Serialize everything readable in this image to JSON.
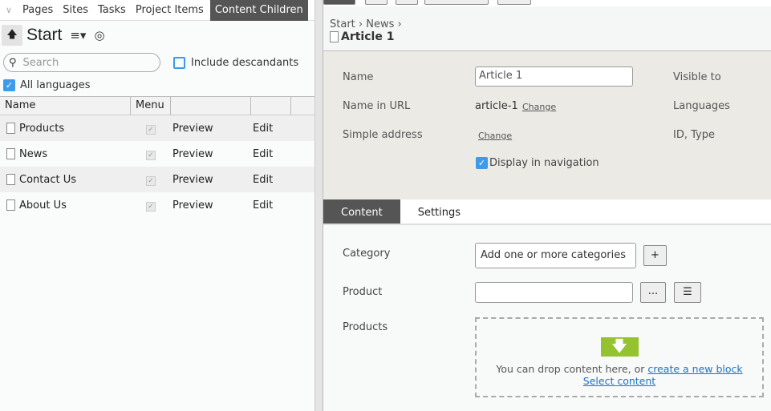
{
  "left": {
    "tabs": [
      "Pages",
      "Sites",
      "Tasks",
      "Project Items",
      "Content Children"
    ],
    "active_tab": "Content Children",
    "title": "Start",
    "search_placeholder": "Search",
    "include_descendants": "Include descandants",
    "all_languages": "All languages",
    "columns": [
      "Name",
      "Menu",
      "",
      "",
      ""
    ],
    "rows": [
      {
        "name": "Products",
        "preview": "Preview",
        "edit": "Edit"
      },
      {
        "name": "News",
        "preview": "Preview",
        "edit": "Edit"
      },
      {
        "name": "Contact Us",
        "preview": "Preview",
        "edit": "Edit"
      },
      {
        "name": "About Us",
        "preview": "Preview",
        "edit": "Edit"
      }
    ]
  },
  "right": {
    "breadcrumb": [
      "Start",
      "News"
    ],
    "title": "Article 1",
    "props": {
      "name_label": "Name",
      "name_value": "Article 1",
      "url_label": "Name in URL",
      "url_value": "article-1",
      "change": "Change",
      "simple_label": "Simple address",
      "display_nav": "Display in navigation",
      "visible_to": "Visible to",
      "languages": "Languages",
      "id_type": "ID, Type"
    },
    "tabs": [
      "Content",
      "Settings"
    ],
    "form": {
      "category_label": "Category",
      "category_value": "Add one or more categories",
      "plus": "+",
      "product_label": "Product",
      "browse": "...",
      "products_label": "Products",
      "drop_text": "You can drop content here, or ",
      "create_link": "create a new block",
      "select_link": "Select content"
    }
  },
  "colors": {
    "accent": "#3d9be9",
    "active_tab": "#555555",
    "drop_arrow": "#95c22f"
  }
}
